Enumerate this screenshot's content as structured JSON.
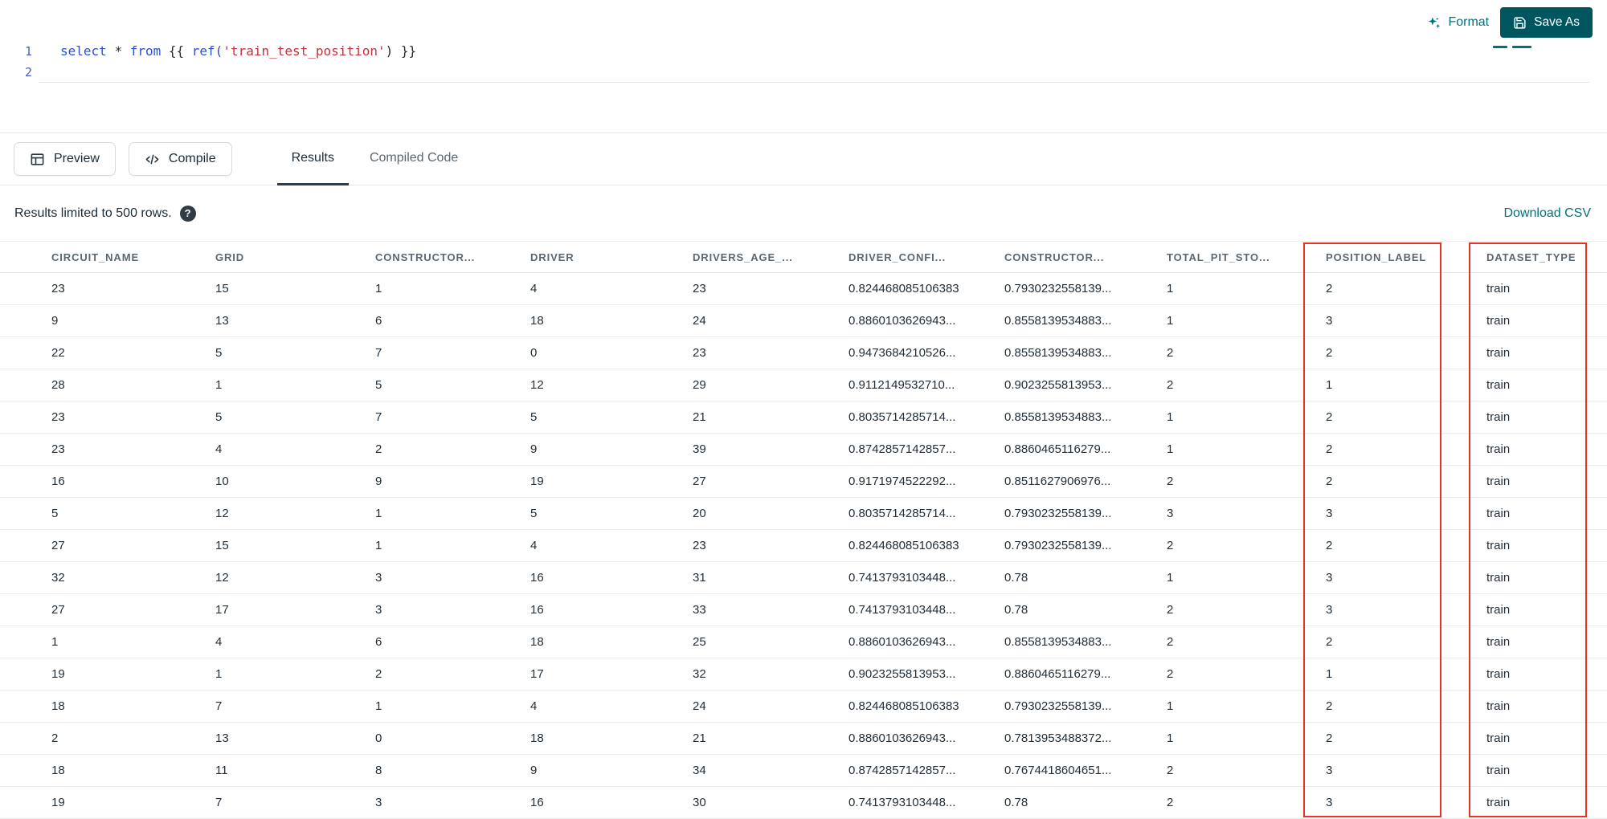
{
  "editor": {
    "lines": [
      {
        "number": "1",
        "tokens": [
          {
            "text": "select",
            "type": "kw"
          },
          {
            "text": " ",
            "type": "plain"
          },
          {
            "text": "*",
            "type": "op"
          },
          {
            "text": " ",
            "type": "plain"
          },
          {
            "text": "from",
            "type": "kw"
          },
          {
            "text": " {{ ",
            "type": "plain"
          },
          {
            "text": "ref(",
            "type": "fn"
          },
          {
            "text": "'train_test_position'",
            "type": "str"
          },
          {
            "text": ") }}",
            "type": "plain"
          }
        ]
      },
      {
        "number": "2",
        "tokens": []
      }
    ],
    "actions": {
      "format_label": "Format",
      "save_as_label": "Save As"
    }
  },
  "toolbar": {
    "preview_label": "Preview",
    "compile_label": "Compile",
    "tabs": [
      {
        "label": "Results",
        "active": true
      },
      {
        "label": "Compiled Code",
        "active": false
      }
    ]
  },
  "results": {
    "limit_text": "Results limited to 500 rows.",
    "download_label": "Download CSV"
  },
  "table": {
    "headers": [
      "CIRCUIT_NAME",
      "GRID",
      "CONSTRUCTOR...",
      "DRIVER",
      "DRIVERS_AGE_...",
      "DRIVER_CONFI...",
      "CONSTRUCTOR...",
      "TOTAL_PIT_STO...",
      "POSITION_LABEL",
      "DATASET_TYPE"
    ],
    "highlighted_columns": [
      "POSITION_LABEL",
      "DATASET_TYPE"
    ],
    "rows": [
      [
        "23",
        "15",
        "1",
        "4",
        "23",
        "0.824468085106383",
        "0.7930232558139...",
        "1",
        "2",
        "train"
      ],
      [
        "9",
        "13",
        "6",
        "18",
        "24",
        "0.8860103626943...",
        "0.8558139534883...",
        "1",
        "3",
        "train"
      ],
      [
        "22",
        "5",
        "7",
        "0",
        "23",
        "0.9473684210526...",
        "0.8558139534883...",
        "2",
        "2",
        "train"
      ],
      [
        "28",
        "1",
        "5",
        "12",
        "29",
        "0.9112149532710...",
        "0.9023255813953...",
        "2",
        "1",
        "train"
      ],
      [
        "23",
        "5",
        "7",
        "5",
        "21",
        "0.8035714285714...",
        "0.8558139534883...",
        "1",
        "2",
        "train"
      ],
      [
        "23",
        "4",
        "2",
        "9",
        "39",
        "0.8742857142857...",
        "0.8860465116279...",
        "1",
        "2",
        "train"
      ],
      [
        "16",
        "10",
        "9",
        "19",
        "27",
        "0.9171974522292...",
        "0.8511627906976...",
        "2",
        "2",
        "train"
      ],
      [
        "5",
        "12",
        "1",
        "5",
        "20",
        "0.8035714285714...",
        "0.7930232558139...",
        "3",
        "3",
        "train"
      ],
      [
        "27",
        "15",
        "1",
        "4",
        "23",
        "0.824468085106383",
        "0.7930232558139...",
        "2",
        "2",
        "train"
      ],
      [
        "32",
        "12",
        "3",
        "16",
        "31",
        "0.7413793103448...",
        "0.78",
        "1",
        "3",
        "train"
      ],
      [
        "27",
        "17",
        "3",
        "16",
        "33",
        "0.7413793103448...",
        "0.78",
        "2",
        "3",
        "train"
      ],
      [
        "1",
        "4",
        "6",
        "18",
        "25",
        "0.8860103626943...",
        "0.8558139534883...",
        "2",
        "2",
        "train"
      ],
      [
        "19",
        "1",
        "2",
        "17",
        "32",
        "0.9023255813953...",
        "0.8860465116279...",
        "2",
        "1",
        "train"
      ],
      [
        "18",
        "7",
        "1",
        "4",
        "24",
        "0.824468085106383",
        "0.7930232558139...",
        "1",
        "2",
        "train"
      ],
      [
        "2",
        "13",
        "0",
        "18",
        "21",
        "0.8860103626943...",
        "0.7813953488372...",
        "1",
        "2",
        "train"
      ],
      [
        "18",
        "11",
        "8",
        "9",
        "34",
        "0.8742857142857...",
        "0.7674418604651...",
        "2",
        "3",
        "train"
      ],
      [
        "19",
        "7",
        "3",
        "16",
        "30",
        "0.7413793103448...",
        "0.78",
        "2",
        "3",
        "train"
      ]
    ]
  },
  "colors": {
    "accent": "#00727C",
    "btn": "#00565F",
    "red": "#E93223",
    "kw": "#2D50CE",
    "str": "#C2333F",
    "dark": "#1C2B36"
  }
}
